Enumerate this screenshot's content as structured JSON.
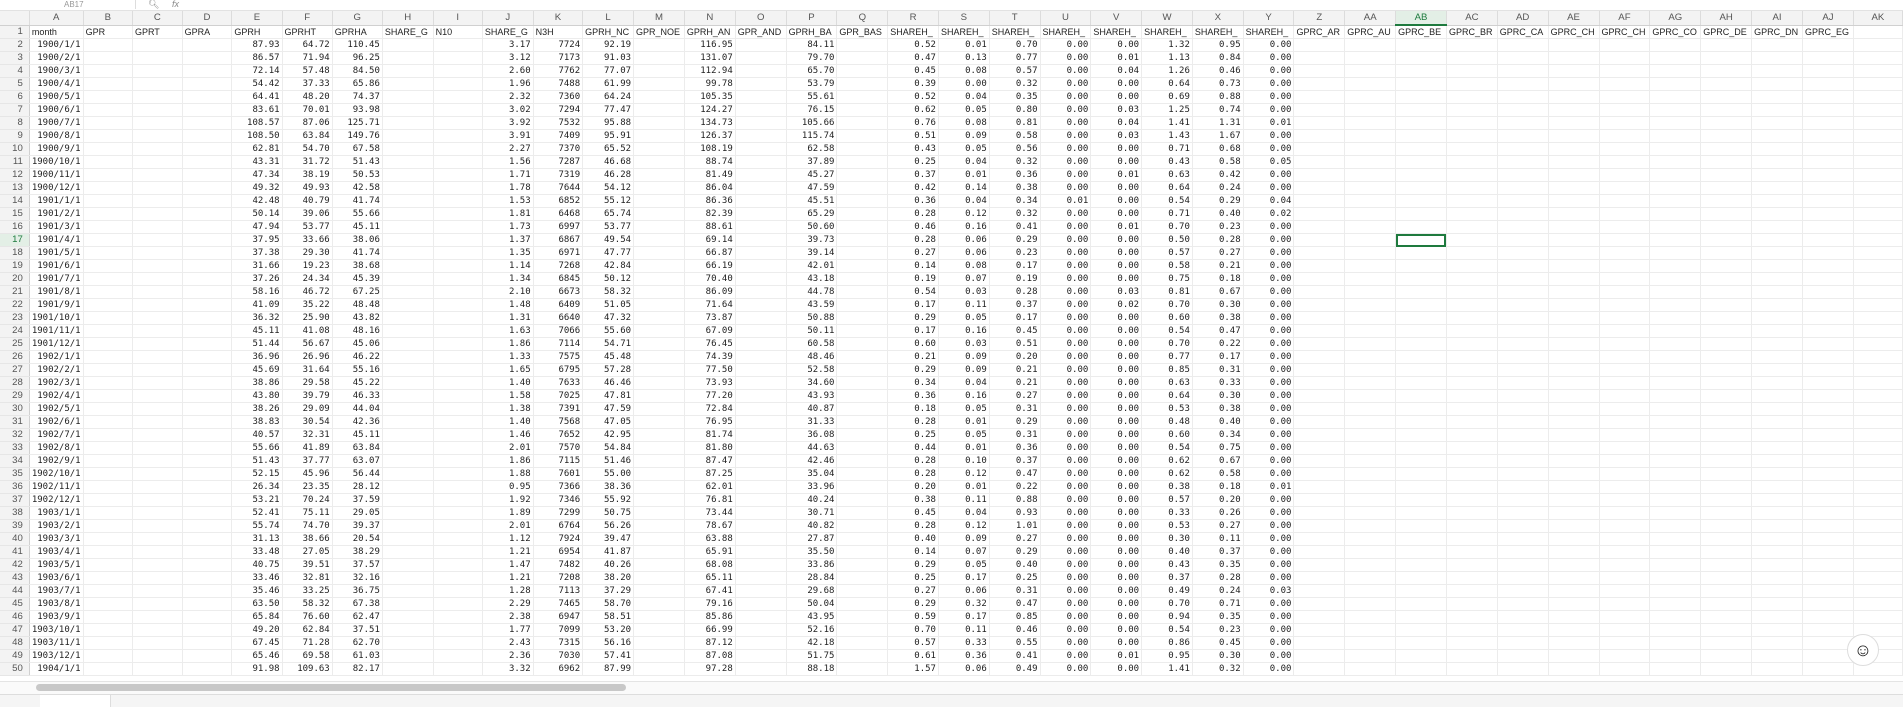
{
  "formula_bar": {
    "name_box": "AB17",
    "search_icon": "search-icon",
    "fx_icon": "function-icon"
  },
  "columns": [
    "A",
    "B",
    "C",
    "D",
    "E",
    "F",
    "G",
    "H",
    "I",
    "J",
    "K",
    "L",
    "M",
    "N",
    "O",
    "P",
    "Q",
    "R",
    "S",
    "T",
    "U",
    "V",
    "W",
    "X",
    "Y",
    "Z",
    "AA",
    "AB",
    "AC",
    "AD",
    "AE",
    "AF",
    "AG",
    "AH",
    "AI",
    "AJ",
    "AK"
  ],
  "selected_column": "AB",
  "selected_row": 17,
  "header_row": [
    "month",
    "GPR",
    "GPRT",
    "GPRA",
    "GPRH",
    "GPRHT",
    "GPRHA",
    "SHARE_G",
    "N10",
    "SHARE_G",
    "N3H",
    "GPRH_NC",
    "GPR_NOE",
    "GPRH_AN",
    "GPR_AND",
    "GPRH_BA",
    "GPR_BAS",
    "SHAREH_",
    "SHAREH_",
    "SHAREH_",
    "SHAREH_",
    "SHAREH_",
    "SHAREH_",
    "SHAREH_",
    "SHAREH_",
    "GPRC_AR",
    "GPRC_AU",
    "GPRC_BE",
    "GPRC_BR",
    "GPRC_CA",
    "GPRC_CH",
    "GPRC_CH",
    "GPRC_CO",
    "GPRC_DE",
    "GPRC_DN",
    "GPRC_EG"
  ],
  "rows": [
    [
      "1900/1/1",
      "",
      "",
      "",
      "87.93",
      "64.72",
      "110.45",
      "",
      "",
      "3.17",
      "7724",
      "92.19",
      "",
      "116.95",
      "",
      "84.11",
      "",
      "0.52",
      "0.01",
      "0.70",
      "0.00",
      "0.00",
      "1.32",
      "0.95",
      "0.00"
    ],
    [
      "1900/2/1",
      "",
      "",
      "",
      "86.57",
      "71.94",
      "96.25",
      "",
      "",
      "3.12",
      "7173",
      "91.03",
      "",
      "131.07",
      "",
      "79.70",
      "",
      "0.47",
      "0.13",
      "0.77",
      "0.00",
      "0.01",
      "1.13",
      "0.84",
      "0.00"
    ],
    [
      "1900/3/1",
      "",
      "",
      "",
      "72.14",
      "57.48",
      "84.50",
      "",
      "",
      "2.60",
      "7762",
      "77.07",
      "",
      "112.94",
      "",
      "65.70",
      "",
      "0.45",
      "0.08",
      "0.57",
      "0.00",
      "0.04",
      "1.26",
      "0.46",
      "0.00"
    ],
    [
      "1900/4/1",
      "",
      "",
      "",
      "54.42",
      "37.33",
      "65.86",
      "",
      "",
      "1.96",
      "7488",
      "61.99",
      "",
      "99.78",
      "",
      "53.79",
      "",
      "0.39",
      "0.00",
      "0.32",
      "0.00",
      "0.00",
      "0.64",
      "0.73",
      "0.00"
    ],
    [
      "1900/5/1",
      "",
      "",
      "",
      "64.41",
      "48.20",
      "74.37",
      "",
      "",
      "2.32",
      "7360",
      "64.24",
      "",
      "105.35",
      "",
      "55.61",
      "",
      "0.52",
      "0.04",
      "0.35",
      "0.00",
      "0.00",
      "0.69",
      "0.88",
      "0.00"
    ],
    [
      "1900/6/1",
      "",
      "",
      "",
      "83.61",
      "70.01",
      "93.98",
      "",
      "",
      "3.02",
      "7294",
      "77.47",
      "",
      "124.27",
      "",
      "76.15",
      "",
      "0.62",
      "0.05",
      "0.80",
      "0.00",
      "0.03",
      "1.25",
      "0.74",
      "0.00"
    ],
    [
      "1900/7/1",
      "",
      "",
      "",
      "108.57",
      "87.06",
      "125.71",
      "",
      "",
      "3.92",
      "7532",
      "95.88",
      "",
      "134.73",
      "",
      "105.66",
      "",
      "0.76",
      "0.08",
      "0.81",
      "0.00",
      "0.04",
      "1.41",
      "1.31",
      "0.01"
    ],
    [
      "1900/8/1",
      "",
      "",
      "",
      "108.50",
      "63.84",
      "149.76",
      "",
      "",
      "3.91",
      "7409",
      "95.91",
      "",
      "126.37",
      "",
      "115.74",
      "",
      "0.51",
      "0.09",
      "0.58",
      "0.00",
      "0.03",
      "1.43",
      "1.67",
      "0.00"
    ],
    [
      "1900/9/1",
      "",
      "",
      "",
      "62.81",
      "54.70",
      "67.58",
      "",
      "",
      "2.27",
      "7370",
      "65.52",
      "",
      "108.19",
      "",
      "62.58",
      "",
      "0.43",
      "0.05",
      "0.56",
      "0.00",
      "0.00",
      "0.71",
      "0.68",
      "0.00"
    ],
    [
      "1900/10/1",
      "",
      "",
      "",
      "43.31",
      "31.72",
      "51.43",
      "",
      "",
      "1.56",
      "7287",
      "46.68",
      "",
      "88.74",
      "",
      "37.89",
      "",
      "0.25",
      "0.04",
      "0.32",
      "0.00",
      "0.00",
      "0.43",
      "0.58",
      "0.05"
    ],
    [
      "1900/11/1",
      "",
      "",
      "",
      "47.34",
      "38.19",
      "50.53",
      "",
      "",
      "1.71",
      "7319",
      "46.28",
      "",
      "81.49",
      "",
      "45.27",
      "",
      "0.37",
      "0.01",
      "0.36",
      "0.00",
      "0.01",
      "0.63",
      "0.42",
      "0.00"
    ],
    [
      "1900/12/1",
      "",
      "",
      "",
      "49.32",
      "49.93",
      "42.58",
      "",
      "",
      "1.78",
      "7644",
      "54.12",
      "",
      "86.04",
      "",
      "47.59",
      "",
      "0.42",
      "0.14",
      "0.38",
      "0.00",
      "0.00",
      "0.64",
      "0.24",
      "0.00"
    ],
    [
      "1901/1/1",
      "",
      "",
      "",
      "42.48",
      "40.79",
      "41.74",
      "",
      "",
      "1.53",
      "6852",
      "55.12",
      "",
      "86.36",
      "",
      "45.51",
      "",
      "0.36",
      "0.04",
      "0.34",
      "0.01",
      "0.00",
      "0.54",
      "0.29",
      "0.04"
    ],
    [
      "1901/2/1",
      "",
      "",
      "",
      "50.14",
      "39.06",
      "55.66",
      "",
      "",
      "1.81",
      "6468",
      "65.74",
      "",
      "82.39",
      "",
      "65.29",
      "",
      "0.28",
      "0.12",
      "0.32",
      "0.00",
      "0.00",
      "0.71",
      "0.40",
      "0.02"
    ],
    [
      "1901/3/1",
      "",
      "",
      "",
      "47.94",
      "53.77",
      "45.11",
      "",
      "",
      "1.73",
      "6997",
      "53.77",
      "",
      "88.61",
      "",
      "50.60",
      "",
      "0.46",
      "0.16",
      "0.41",
      "0.00",
      "0.01",
      "0.70",
      "0.23",
      "0.00"
    ],
    [
      "1901/4/1",
      "",
      "",
      "",
      "37.95",
      "33.66",
      "38.06",
      "",
      "",
      "1.37",
      "6867",
      "49.54",
      "",
      "69.14",
      "",
      "39.73",
      "",
      "0.28",
      "0.06",
      "0.29",
      "0.00",
      "0.00",
      "0.50",
      "0.28",
      "0.00"
    ],
    [
      "1901/5/1",
      "",
      "",
      "",
      "37.38",
      "29.30",
      "41.74",
      "",
      "",
      "1.35",
      "6971",
      "47.77",
      "",
      "66.87",
      "",
      "39.14",
      "",
      "0.27",
      "0.06",
      "0.23",
      "0.00",
      "0.00",
      "0.57",
      "0.27",
      "0.00"
    ],
    [
      "1901/6/1",
      "",
      "",
      "",
      "31.66",
      "19.23",
      "38.68",
      "",
      "",
      "1.14",
      "7268",
      "42.84",
      "",
      "66.19",
      "",
      "42.01",
      "",
      "0.14",
      "0.08",
      "0.17",
      "0.00",
      "0.00",
      "0.58",
      "0.21",
      "0.00"
    ],
    [
      "1901/7/1",
      "",
      "",
      "",
      "37.26",
      "24.34",
      "45.39",
      "",
      "",
      "1.34",
      "6845",
      "50.12",
      "",
      "70.40",
      "",
      "43.18",
      "",
      "0.19",
      "0.07",
      "0.19",
      "0.00",
      "0.00",
      "0.75",
      "0.18",
      "0.00"
    ],
    [
      "1901/8/1",
      "",
      "",
      "",
      "58.16",
      "46.72",
      "67.25",
      "",
      "",
      "2.10",
      "6673",
      "58.32",
      "",
      "86.09",
      "",
      "44.78",
      "",
      "0.54",
      "0.03",
      "0.28",
      "0.00",
      "0.03",
      "0.81",
      "0.67",
      "0.00"
    ],
    [
      "1901/9/1",
      "",
      "",
      "",
      "41.09",
      "35.22",
      "48.48",
      "",
      "",
      "1.48",
      "6409",
      "51.05",
      "",
      "71.64",
      "",
      "43.59",
      "",
      "0.17",
      "0.11",
      "0.37",
      "0.00",
      "0.02",
      "0.70",
      "0.30",
      "0.00"
    ],
    [
      "1901/10/1",
      "",
      "",
      "",
      "36.32",
      "25.90",
      "43.82",
      "",
      "",
      "1.31",
      "6640",
      "47.32",
      "",
      "73.87",
      "",
      "50.88",
      "",
      "0.29",
      "0.05",
      "0.17",
      "0.00",
      "0.00",
      "0.60",
      "0.38",
      "0.00"
    ],
    [
      "1901/11/1",
      "",
      "",
      "",
      "45.11",
      "41.08",
      "48.16",
      "",
      "",
      "1.63",
      "7066",
      "55.60",
      "",
      "67.09",
      "",
      "50.11",
      "",
      "0.17",
      "0.16",
      "0.45",
      "0.00",
      "0.00",
      "0.54",
      "0.47",
      "0.00"
    ],
    [
      "1901/12/1",
      "",
      "",
      "",
      "51.44",
      "56.67",
      "45.06",
      "",
      "",
      "1.86",
      "7114",
      "54.71",
      "",
      "76.45",
      "",
      "60.58",
      "",
      "0.60",
      "0.03",
      "0.51",
      "0.00",
      "0.00",
      "0.70",
      "0.22",
      "0.00"
    ],
    [
      "1902/1/1",
      "",
      "",
      "",
      "36.96",
      "26.96",
      "46.22",
      "",
      "",
      "1.33",
      "7575",
      "45.48",
      "",
      "74.39",
      "",
      "48.46",
      "",
      "0.21",
      "0.09",
      "0.20",
      "0.00",
      "0.00",
      "0.77",
      "0.17",
      "0.00"
    ],
    [
      "1902/2/1",
      "",
      "",
      "",
      "45.69",
      "31.64",
      "55.16",
      "",
      "",
      "1.65",
      "6795",
      "57.28",
      "",
      "77.50",
      "",
      "52.58",
      "",
      "0.29",
      "0.09",
      "0.21",
      "0.00",
      "0.00",
      "0.85",
      "0.31",
      "0.00"
    ],
    [
      "1902/3/1",
      "",
      "",
      "",
      "38.86",
      "29.58",
      "45.22",
      "",
      "",
      "1.40",
      "7633",
      "46.46",
      "",
      "73.93",
      "",
      "34.60",
      "",
      "0.34",
      "0.04",
      "0.21",
      "0.00",
      "0.00",
      "0.63",
      "0.33",
      "0.00"
    ],
    [
      "1902/4/1",
      "",
      "",
      "",
      "43.80",
      "39.79",
      "46.33",
      "",
      "",
      "1.58",
      "7025",
      "47.81",
      "",
      "77.20",
      "",
      "43.93",
      "",
      "0.36",
      "0.16",
      "0.27",
      "0.00",
      "0.00",
      "0.64",
      "0.30",
      "0.00"
    ],
    [
      "1902/5/1",
      "",
      "",
      "",
      "38.26",
      "29.09",
      "44.04",
      "",
      "",
      "1.38",
      "7391",
      "47.59",
      "",
      "72.84",
      "",
      "40.87",
      "",
      "0.18",
      "0.05",
      "0.31",
      "0.00",
      "0.00",
      "0.53",
      "0.38",
      "0.00"
    ],
    [
      "1902/6/1",
      "",
      "",
      "",
      "38.83",
      "30.54",
      "42.36",
      "",
      "",
      "1.40",
      "7568",
      "47.05",
      "",
      "76.95",
      "",
      "31.33",
      "",
      "0.28",
      "0.01",
      "0.29",
      "0.00",
      "0.00",
      "0.48",
      "0.40",
      "0.00"
    ],
    [
      "1902/7/1",
      "",
      "",
      "",
      "40.57",
      "32.31",
      "45.11",
      "",
      "",
      "1.46",
      "7652",
      "42.95",
      "",
      "81.74",
      "",
      "36.08",
      "",
      "0.25",
      "0.05",
      "0.31",
      "0.00",
      "0.00",
      "0.60",
      "0.34",
      "0.00"
    ],
    [
      "1902/8/1",
      "",
      "",
      "",
      "55.66",
      "41.89",
      "63.84",
      "",
      "",
      "2.01",
      "7570",
      "54.84",
      "",
      "81.80",
      "",
      "44.63",
      "",
      "0.44",
      "0.01",
      "0.36",
      "0.00",
      "0.00",
      "0.54",
      "0.75",
      "0.00"
    ],
    [
      "1902/9/1",
      "",
      "",
      "",
      "51.43",
      "37.77",
      "63.07",
      "",
      "",
      "1.86",
      "7115",
      "51.46",
      "",
      "87.47",
      "",
      "42.46",
      "",
      "0.28",
      "0.10",
      "0.37",
      "0.00",
      "0.00",
      "0.62",
      "0.67",
      "0.00"
    ],
    [
      "1902/10/1",
      "",
      "",
      "",
      "52.15",
      "45.96",
      "56.44",
      "",
      "",
      "1.88",
      "7601",
      "55.00",
      "",
      "87.25",
      "",
      "35.04",
      "",
      "0.28",
      "0.12",
      "0.47",
      "0.00",
      "0.00",
      "0.62",
      "0.58",
      "0.00"
    ],
    [
      "1902/11/1",
      "",
      "",
      "",
      "26.34",
      "23.35",
      "28.12",
      "",
      "",
      "0.95",
      "7366",
      "38.36",
      "",
      "62.01",
      "",
      "33.96",
      "",
      "0.20",
      "0.01",
      "0.22",
      "0.00",
      "0.00",
      "0.38",
      "0.18",
      "0.01"
    ],
    [
      "1902/12/1",
      "",
      "",
      "",
      "53.21",
      "70.24",
      "37.59",
      "",
      "",
      "1.92",
      "7346",
      "55.92",
      "",
      "76.81",
      "",
      "40.24",
      "",
      "0.38",
      "0.11",
      "0.88",
      "0.00",
      "0.00",
      "0.57",
      "0.20",
      "0.00"
    ],
    [
      "1903/1/1",
      "",
      "",
      "",
      "52.41",
      "75.11",
      "29.05",
      "",
      "",
      "1.89",
      "7299",
      "50.75",
      "",
      "73.44",
      "",
      "30.71",
      "",
      "0.45",
      "0.04",
      "0.93",
      "0.00",
      "0.00",
      "0.33",
      "0.26",
      "0.00"
    ],
    [
      "1903/2/1",
      "",
      "",
      "",
      "55.74",
      "74.70",
      "39.37",
      "",
      "",
      "2.01",
      "6764",
      "56.26",
      "",
      "78.67",
      "",
      "40.82",
      "",
      "0.28",
      "0.12",
      "1.01",
      "0.00",
      "0.00",
      "0.53",
      "0.27",
      "0.00"
    ],
    [
      "1903/3/1",
      "",
      "",
      "",
      "31.13",
      "38.66",
      "20.54",
      "",
      "",
      "1.12",
      "7924",
      "39.47",
      "",
      "63.88",
      "",
      "27.87",
      "",
      "0.40",
      "0.09",
      "0.27",
      "0.00",
      "0.00",
      "0.30",
      "0.11",
      "0.00"
    ],
    [
      "1903/4/1",
      "",
      "",
      "",
      "33.48",
      "27.05",
      "38.29",
      "",
      "",
      "1.21",
      "6954",
      "41.87",
      "",
      "65.91",
      "",
      "35.50",
      "",
      "0.14",
      "0.07",
      "0.29",
      "0.00",
      "0.00",
      "0.40",
      "0.37",
      "0.00"
    ],
    [
      "1903/5/1",
      "",
      "",
      "",
      "40.75",
      "39.51",
      "37.57",
      "",
      "",
      "1.47",
      "7482",
      "40.26",
      "",
      "68.08",
      "",
      "33.86",
      "",
      "0.29",
      "0.05",
      "0.40",
      "0.00",
      "0.00",
      "0.43",
      "0.35",
      "0.00"
    ],
    [
      "1903/6/1",
      "",
      "",
      "",
      "33.46",
      "32.81",
      "32.16",
      "",
      "",
      "1.21",
      "7208",
      "38.20",
      "",
      "65.11",
      "",
      "28.84",
      "",
      "0.25",
      "0.17",
      "0.25",
      "0.00",
      "0.00",
      "0.37",
      "0.28",
      "0.00"
    ],
    [
      "1903/7/1",
      "",
      "",
      "",
      "35.46",
      "33.25",
      "36.75",
      "",
      "",
      "1.28",
      "7113",
      "37.29",
      "",
      "67.41",
      "",
      "29.68",
      "",
      "0.27",
      "0.06",
      "0.31",
      "0.00",
      "0.00",
      "0.49",
      "0.24",
      "0.03"
    ],
    [
      "1903/8/1",
      "",
      "",
      "",
      "63.50",
      "58.32",
      "67.38",
      "",
      "",
      "2.29",
      "7465",
      "58.70",
      "",
      "79.16",
      "",
      "50.04",
      "",
      "0.29",
      "0.32",
      "0.47",
      "0.00",
      "0.00",
      "0.70",
      "0.71",
      "0.00"
    ],
    [
      "1903/9/1",
      "",
      "",
      "",
      "65.84",
      "76.60",
      "62.47",
      "",
      "",
      "2.38",
      "6947",
      "58.51",
      "",
      "85.86",
      "",
      "43.95",
      "",
      "0.59",
      "0.17",
      "0.85",
      "0.00",
      "0.00",
      "0.94",
      "0.35",
      "0.00"
    ],
    [
      "1903/10/1",
      "",
      "",
      "",
      "49.20",
      "62.84",
      "37.51",
      "",
      "",
      "1.77",
      "7099",
      "53.20",
      "",
      "66.99",
      "",
      "52.16",
      "",
      "0.70",
      "0.11",
      "0.46",
      "0.00",
      "0.00",
      "0.54",
      "0.23",
      "0.00"
    ],
    [
      "1903/11/1",
      "",
      "",
      "",
      "67.45",
      "71.28",
      "62.70",
      "",
      "",
      "2.43",
      "7315",
      "56.16",
      "",
      "87.12",
      "",
      "42.18",
      "",
      "0.57",
      "0.33",
      "0.55",
      "0.00",
      "0.00",
      "0.86",
      "0.45",
      "0.00"
    ],
    [
      "1903/12/1",
      "",
      "",
      "",
      "65.46",
      "69.58",
      "61.03",
      "",
      "",
      "2.36",
      "7030",
      "57.41",
      "",
      "87.08",
      "",
      "51.75",
      "",
      "0.61",
      "0.36",
      "0.41",
      "0.00",
      "0.01",
      "0.95",
      "0.30",
      "0.00"
    ],
    [
      "1904/1/1",
      "",
      "",
      "",
      "91.98",
      "109.63",
      "82.17",
      "",
      "",
      "3.32",
      "6962",
      "87.99",
      "",
      "97.28",
      "",
      "88.18",
      "",
      "1.57",
      "0.06",
      "0.49",
      "0.00",
      "0.00",
      "1.41",
      "0.32",
      "0.00"
    ]
  ]
}
